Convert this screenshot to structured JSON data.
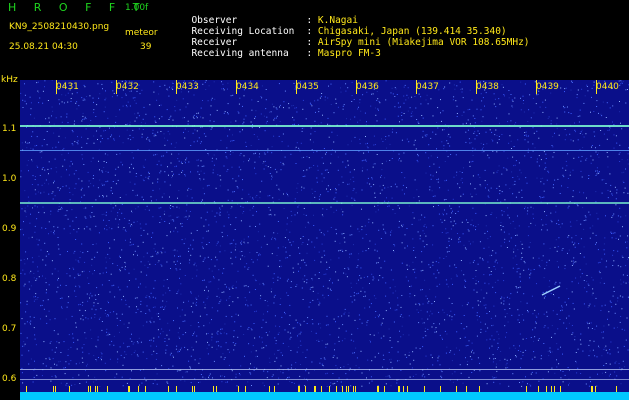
{
  "header": {
    "app_title": "H R O F F T",
    "version": "1.00f",
    "filename": "KN9_2508210430.png",
    "meteor_label": "meteor",
    "timestamp": "25.08.21 04:30",
    "meteor_count": "39"
  },
  "meta": {
    "rows": [
      {
        "key": "Observer",
        "value": "K.Nagai"
      },
      {
        "key": "Receiving Location",
        "value": "Chigasaki, Japan (139.414 35.340)"
      },
      {
        "key": "Receiver",
        "value": "AirSpy mini (Miakejima VOR 108.65MHz)"
      },
      {
        "key": "Receiving antenna",
        "value": "Maspro FM-3"
      }
    ]
  },
  "axis": {
    "y_unit": "kHz",
    "y_ticks": [
      "1.1",
      "1.0",
      "0.9",
      "0.8",
      "0.7",
      "0.6"
    ],
    "x_ticks": [
      "0431",
      "0432",
      "0433",
      "0434",
      "0435",
      "0436",
      "0437",
      "0438",
      "0439",
      "0440"
    ]
  },
  "colors": {
    "background": "#0a0f8a",
    "noise": "#3050ff",
    "line": "#7fffd4",
    "text_yellow": "#ffe81a",
    "text_green": "#1fd41f",
    "bottom_band": "#00c8ff"
  }
}
